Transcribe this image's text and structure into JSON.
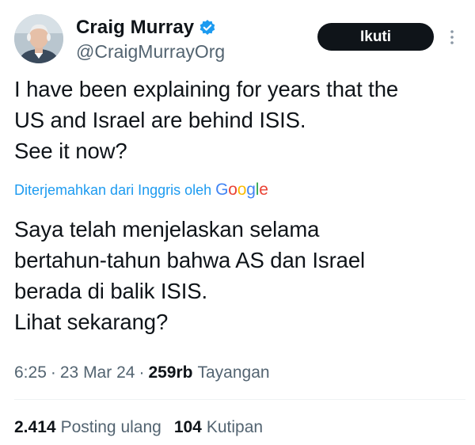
{
  "author": {
    "display_name": "Craig Murray",
    "handle": "@CraigMurrayOrg",
    "verified_icon": "verified-badge-icon",
    "verified_color": "#1d9bf0"
  },
  "header": {
    "follow_label": "Ikuti",
    "more_icon": "more-vertical-icon"
  },
  "tweet": {
    "text": "I have been explaining for years that the\nUS and Israel are behind ISIS.\nSee it now?",
    "translated_label": "Diterjemahkan dari Inggris oleh",
    "translator_logo": {
      "letters": [
        "G",
        "o",
        "o",
        "g",
        "l",
        "e"
      ],
      "colors": [
        "#4285f4",
        "#ea4335",
        "#fbbc05",
        "#4285f4",
        "#34a853",
        "#ea4335"
      ]
    },
    "translated_text": "Saya telah menjelaskan selama\nbertahun-tahun bahwa AS dan Israel\nberada di balik ISIS.\nLihat sekarang?"
  },
  "meta": {
    "time": "6:25",
    "separator": "·",
    "date": "23 Mar 24",
    "views_count": "259rb",
    "views_label": "Tayangan"
  },
  "stats": {
    "reposts_count": "2.414",
    "reposts_label": "Posting ulang",
    "quotes_count": "104",
    "quotes_label": "Kutipan"
  }
}
